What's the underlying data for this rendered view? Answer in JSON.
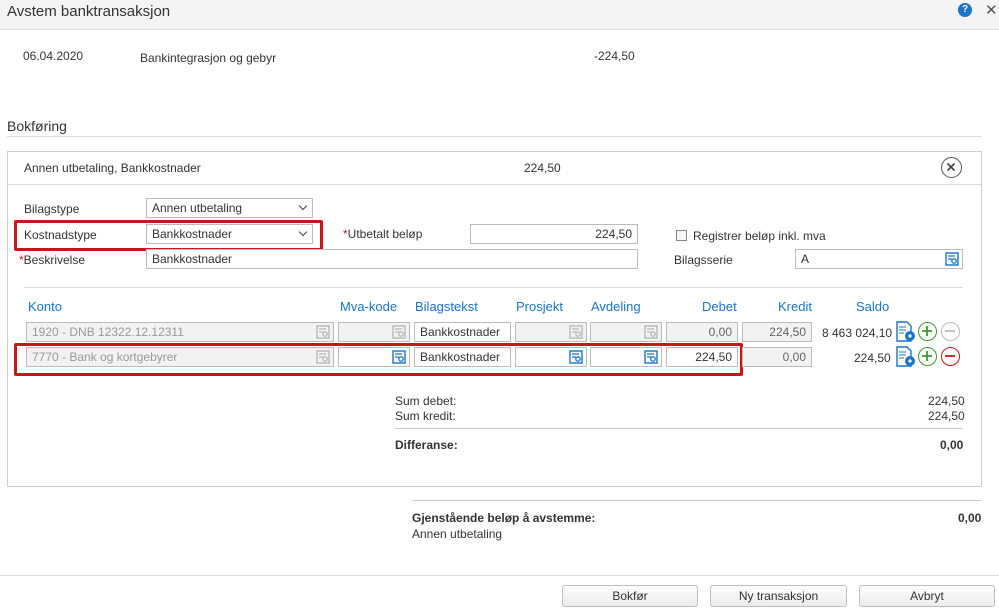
{
  "dialog": {
    "title": "Avstem banktransaksjon",
    "help_label": "?",
    "close_label": "✕"
  },
  "transaction": {
    "date": "06.04.2020",
    "description": "Bankintegrasjon og gebyr",
    "amount": "-224,50"
  },
  "section_title": "Bokføring",
  "entry": {
    "summary_label": "Annen utbetaling, Bankkostnader",
    "summary_amount": "224,50",
    "bilagstype_label": "Bilagstype",
    "bilagstype_value": "Annen utbetaling",
    "kostnadstype_label": "Kostnadstype",
    "kostnadstype_value": "Bankkostnader",
    "utbetalt_label": "Utbetalt beløp",
    "utbetalt_value": "224,50",
    "registrer_label": "Registrer beløp inkl. mva",
    "beskrivelse_label": "Beskrivelse",
    "beskrivelse_value": "Bankkostnader",
    "bilagsserie_label": "Bilagsserie",
    "bilagsserie_value": "A",
    "required_mark": "*"
  },
  "table": {
    "headers": {
      "konto": "Konto",
      "mva": "Mva-kode",
      "bilagstekst": "Bilagstekst",
      "prosjekt": "Prosjekt",
      "avdeling": "Avdeling",
      "debet": "Debet",
      "kredit": "Kredit",
      "saldo": "Saldo"
    },
    "rows": [
      {
        "konto": "1920 - DNB 12322.12.12311",
        "bilagstekst": "Bankkostnader",
        "debet": "0,00",
        "kredit": "224,50",
        "saldo": "8 463 024,10"
      },
      {
        "konto": "7770 - Bank og kortgebyrer",
        "bilagstekst": "Bankkostnader",
        "debet": "224,50",
        "kredit": "0,00",
        "saldo": "224,50"
      }
    ]
  },
  "sums": {
    "debet_label": "Sum debet:",
    "debet_value": "224,50",
    "kredit_label": "Sum kredit:",
    "kredit_value": "224,50",
    "diff_label": "Differanse:",
    "diff_value": "0,00"
  },
  "remaining": {
    "label": "Gjenstående beløp å avstemme:",
    "value": "0,00",
    "sub": "Annen utbetaling"
  },
  "buttons": {
    "bokfor": "Bokfør",
    "ny": "Ny transaksjon",
    "avbryt": "Avbryt"
  },
  "colors": {
    "accent": "#1a74c8",
    "highlight": "#c8161d",
    "add": "#3a9a2a",
    "remove": "#c8161d"
  }
}
